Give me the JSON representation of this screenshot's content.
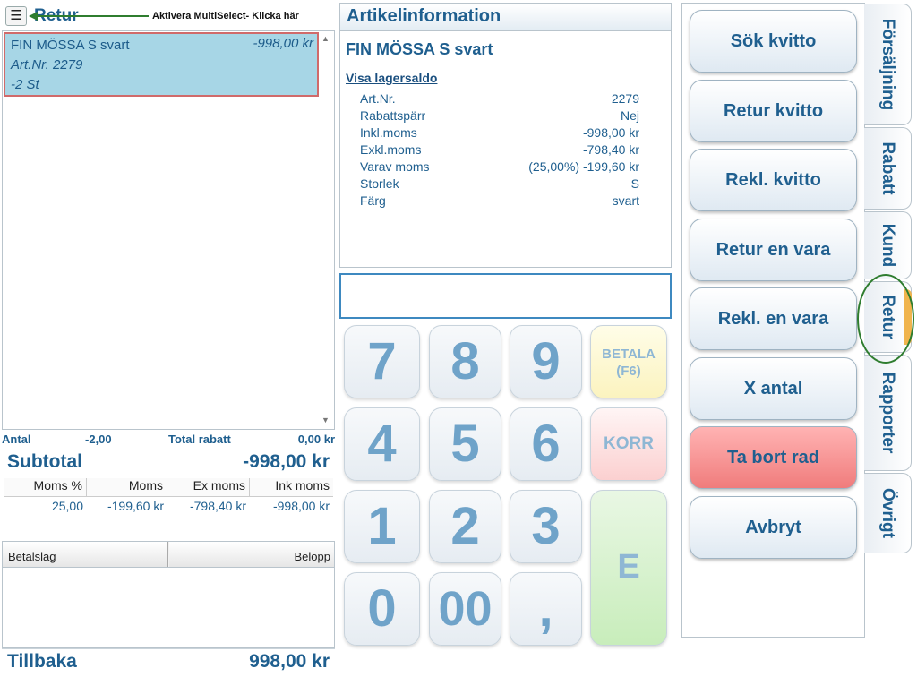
{
  "cart": {
    "title": "Retur",
    "multiselect_icon": "list-icon",
    "multiselect_hint": "Aktivera MultiSelect- Klicka här",
    "items": [
      {
        "name": "FIN MÖSSA S svart",
        "price": "-998,00 kr",
        "artnr": "Art.Nr. 2279",
        "qty": "-2 St"
      }
    ]
  },
  "summary": {
    "antal_label": "Antal",
    "antal_value": "-2,00",
    "rabatt_label": "Total rabatt",
    "rabatt_value": "0,00 kr",
    "subtotal_label": "Subtotal",
    "subtotal_value": "-998,00 kr"
  },
  "vat_table": {
    "headers": [
      "Moms %",
      "Moms",
      "Ex moms",
      "Ink moms"
    ],
    "rows": [
      [
        "25,00",
        "-199,60 kr",
        "-798,40 kr",
        "-998,00 kr"
      ]
    ]
  },
  "payments": {
    "col_type": "Betalslag",
    "col_amount": "Belopp"
  },
  "change": {
    "label": "Tillbaka",
    "value": "998,00 kr"
  },
  "article_info": {
    "title": "Artikelinformation",
    "product_name": "FIN MÖSSA S svart",
    "stock_link": "Visa lagersaldo",
    "rows": [
      {
        "key": "Art.Nr.",
        "value": "2279"
      },
      {
        "key": "Rabattspärr",
        "value": "Nej"
      },
      {
        "key": "Inkl.moms",
        "value": "-998,00 kr"
      },
      {
        "key": "Exkl.moms",
        "value": "-798,40 kr"
      },
      {
        "key": "Varav moms",
        "value": "(25,00%) -199,60 kr"
      },
      {
        "key": "Storlek",
        "value": "S"
      },
      {
        "key": "Färg",
        "value": "svart"
      }
    ]
  },
  "entry": {
    "value": ""
  },
  "keypad": {
    "k7": "7",
    "k8": "8",
    "k9": "9",
    "k4": "4",
    "k5": "5",
    "k6": "6",
    "k1": "1",
    "k2": "2",
    "k3": "3",
    "k0": "0",
    "k00": "00",
    "kcomma": ",",
    "pay": "BETALA (F6)",
    "korr": "KORR",
    "enter": "E"
  },
  "actions": [
    "Sök kvitto",
    "Retur kvitto",
    "Rekl. kvitto",
    "Retur en vara",
    "Rekl. en vara",
    "X antal",
    "Ta bort rad",
    "Avbryt"
  ],
  "tabs": [
    "Försäljning",
    "Rabatt",
    "Kund",
    "Retur",
    "Rapporter",
    "Övrigt"
  ],
  "colors": {
    "accent": "#1f5f8f",
    "selected_row": "#a7d6e6",
    "delete_button": "#f07c7c",
    "active_tab_marker": "#f0b44d",
    "annotation": "#2f7d2f"
  }
}
